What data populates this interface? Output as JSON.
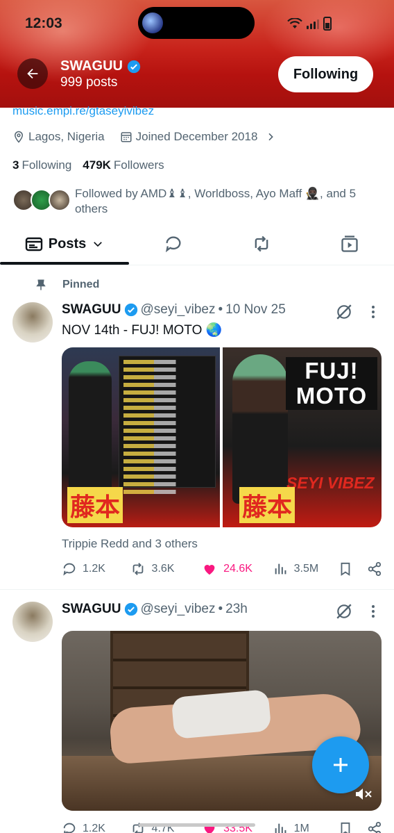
{
  "status": {
    "time": "12:03"
  },
  "header": {
    "name": "SWAGUU",
    "posts_count": "999 posts",
    "following_btn": "Following"
  },
  "profile": {
    "link": "music.empi.re/gtaseyivibez",
    "location": "Lagos, Nigeria",
    "joined": "Joined December 2018",
    "following_count": "3",
    "following_label": "Following",
    "followers_count": "479K",
    "followers_label": "Followers",
    "followed_by": "Followed by AMD♝♝, Worldboss, Ayo Maff 🥷🏿, and 5 others"
  },
  "tabs": {
    "posts": "Posts"
  },
  "colors": {
    "accent": "#1d9bf0",
    "like": "#f91880",
    "banner": "#c8231b"
  },
  "posts": [
    {
      "pinned_label": "Pinned",
      "name": "SWAGUU",
      "handle": "@seyi_vibez",
      "time": "10 Nov 25",
      "text": "NOV 14th - FUJ! MOTO 🌏",
      "media_text": {
        "fuji": "FUJ! MOTO",
        "seyi": "SEYI VIBEZ",
        "kanji": "藤本"
      },
      "liked_by": "Trippie Redd and 3 others",
      "replies": "1.2K",
      "reposts": "3.6K",
      "likes": "24.6K",
      "views": "3.5M"
    },
    {
      "name": "SWAGUU",
      "handle": "@seyi_vibez",
      "time": "23h",
      "replies": "1.2K",
      "reposts": "4.7K",
      "likes": "33.5K",
      "views": "1M"
    }
  ]
}
